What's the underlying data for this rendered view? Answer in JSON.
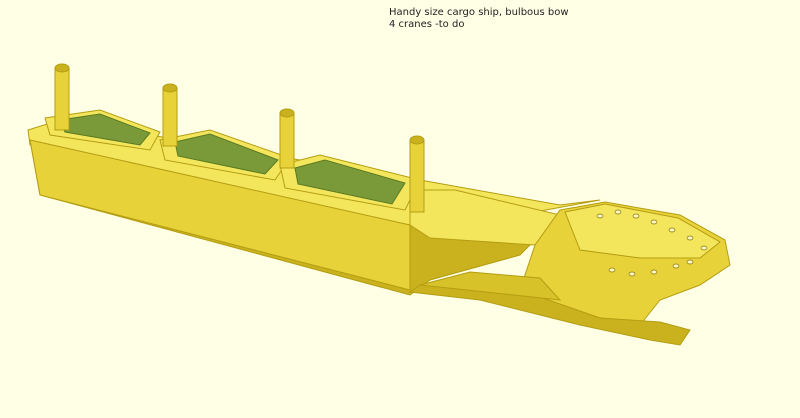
{
  "caption": {
    "line1": "Handy size cargo ship, bulbous bow",
    "line2": "4 cranes -to do"
  },
  "colors": {
    "background": "#ffffe6",
    "hull": "#e8d23a",
    "hull_light": "#f4e65c",
    "hull_dark": "#c9b21e",
    "hold_interior": "#7a9a3a"
  },
  "model": {
    "cranes": 4,
    "cargo_holds": 3
  }
}
